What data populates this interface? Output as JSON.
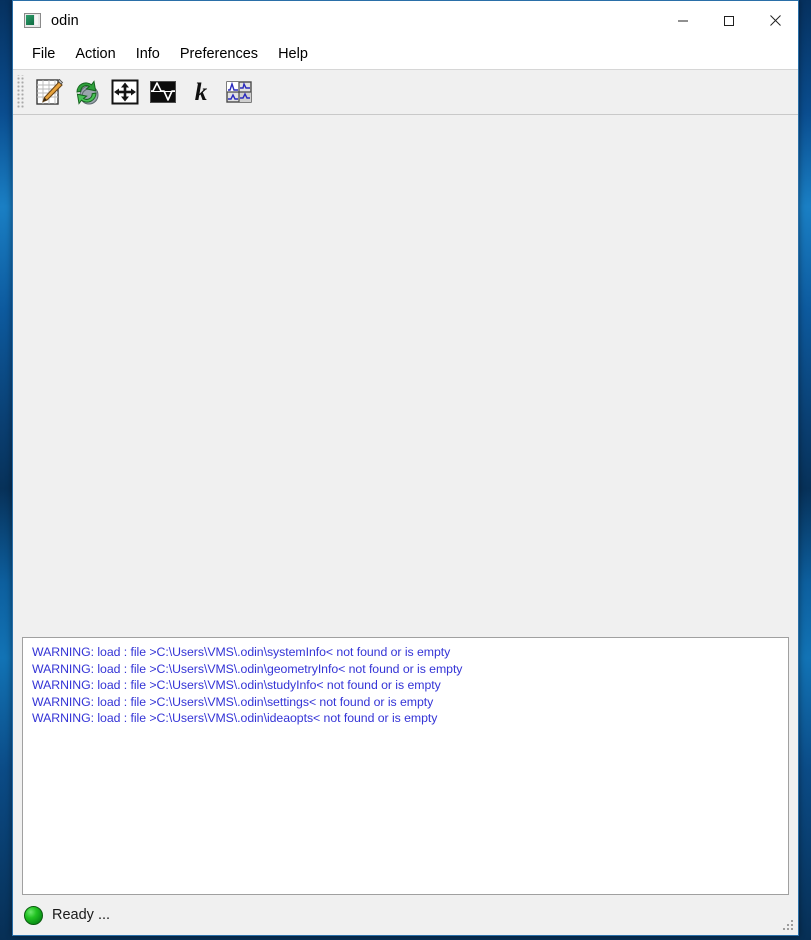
{
  "window": {
    "title": "odin",
    "icon": "app-window-icon",
    "controls": {
      "minimize": "minimize-icon",
      "maximize": "maximize-icon",
      "close": "close-icon"
    }
  },
  "menubar": {
    "items": [
      {
        "label": "File"
      },
      {
        "label": "Action"
      },
      {
        "label": "Info"
      },
      {
        "label": "Preferences"
      },
      {
        "label": "Help"
      }
    ]
  },
  "toolbar": {
    "buttons": [
      {
        "icon": "edit-document-pencil-icon",
        "name": "edit-sequence-button"
      },
      {
        "icon": "refresh-reload-icon",
        "name": "reload-button"
      },
      {
        "icon": "move-arrows-icon",
        "name": "geometry-button"
      },
      {
        "icon": "waveform-plot-icon",
        "name": "plot-button"
      },
      {
        "icon": "k-space-icon",
        "name": "k-space-button"
      },
      {
        "icon": "sequence-diagram-icon",
        "name": "sequence-view-button"
      }
    ]
  },
  "log": {
    "lines": [
      "WARNING: load : file >C:\\Users\\VMS\\.odin\\systemInfo< not found or is empty",
      "WARNING: load : file >C:\\Users\\VMS\\.odin\\geometryInfo< not found or is empty",
      "WARNING: load : file >C:\\Users\\VMS\\.odin\\studyInfo< not found or is empty",
      "WARNING: load : file >C:\\Users\\VMS\\.odin\\settings< not found or is empty",
      "WARNING: load : file >C:\\Users\\VMS\\.odin\\ideaopts< not found or is empty"
    ],
    "text_color": "#3434d6"
  },
  "statusbar": {
    "indicator": "status-led-green",
    "indicator_color": "#22c322",
    "text": "Ready ..."
  }
}
